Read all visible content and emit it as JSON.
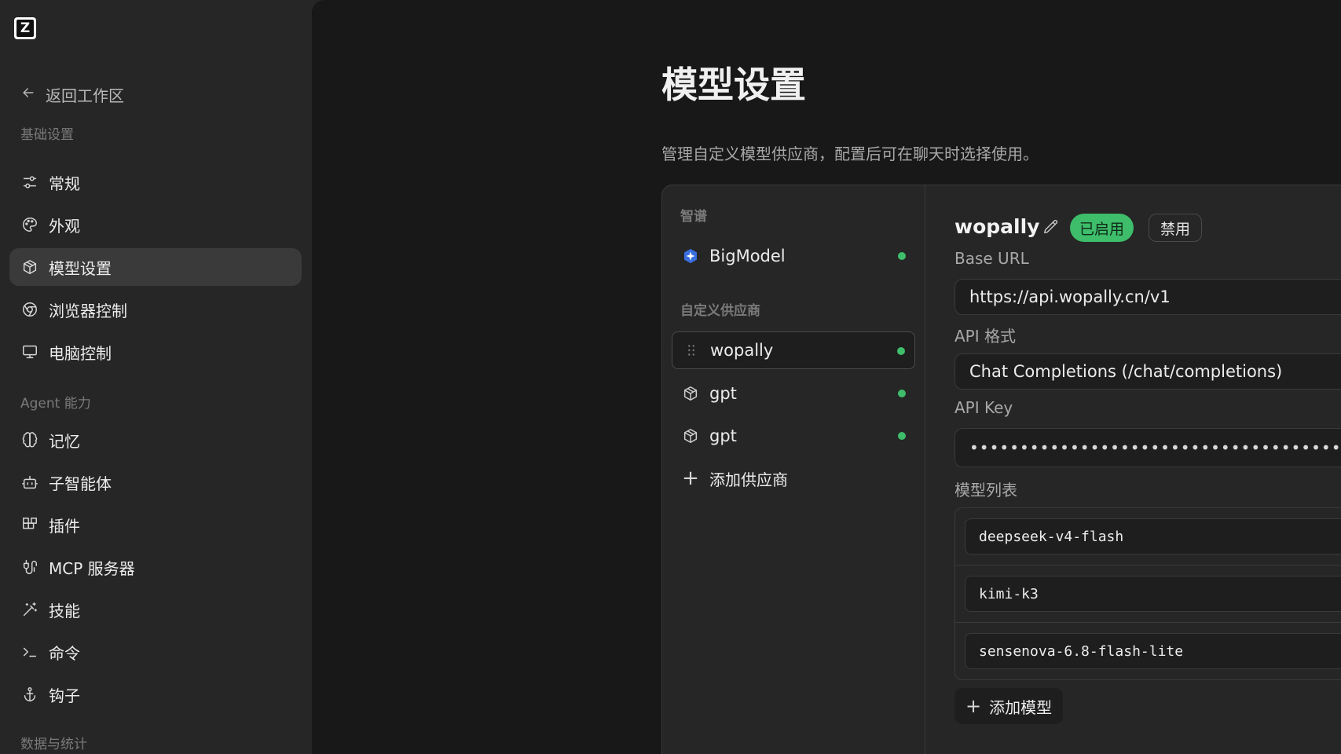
{
  "sidebar": {
    "logo_letter": "Z",
    "back_label": "返回工作区",
    "sections": {
      "basic": "基础设置",
      "agent": "Agent 能力",
      "data": "数据与统计"
    },
    "items": {
      "general": "常规",
      "appearance": "外观",
      "model_settings": "模型设置",
      "browser_control": "浏览器控制",
      "computer_control": "电脑控制",
      "memory": "记忆",
      "sub_agents": "子智能体",
      "plugins": "插件",
      "mcp": "MCP 服务器",
      "skills": "技能",
      "commands": "命令",
      "hooks": "钩子"
    }
  },
  "main": {
    "title": "模型设置",
    "description": "管理自定义模型供应商，配置后可在聊天时选择使用。"
  },
  "providers": {
    "section_zhipu": "智谱",
    "zhipu_item": "BigModel",
    "section_custom": "自定义供应商",
    "custom_items": [
      "wopally",
      "gpt",
      "gpt"
    ],
    "add_label": "添加供应商"
  },
  "detail": {
    "name": "wopally",
    "enabled_badge": "已启用",
    "disable_button": "禁用",
    "base_url_label": "Base URL",
    "base_url_value": "https://api.wopally.cn/v1",
    "api_format_label": "API 格式",
    "api_format_value": "Chat Completions (/chat/completions)",
    "api_key_label": "API Key",
    "api_key_value": "••••••••••••••••••••••••••••••••••••••••••••••••••••••••••••••",
    "models_label": "模型列表",
    "models": [
      "deepseek-v4-flash",
      "kimi-k3",
      "sensenova-6.8-flash-lite"
    ],
    "add_model_label": "添加模型"
  },
  "colors": {
    "accent_green": "#3ebd6a",
    "sidebar_bg": "#262626",
    "main_bg": "#181818"
  }
}
